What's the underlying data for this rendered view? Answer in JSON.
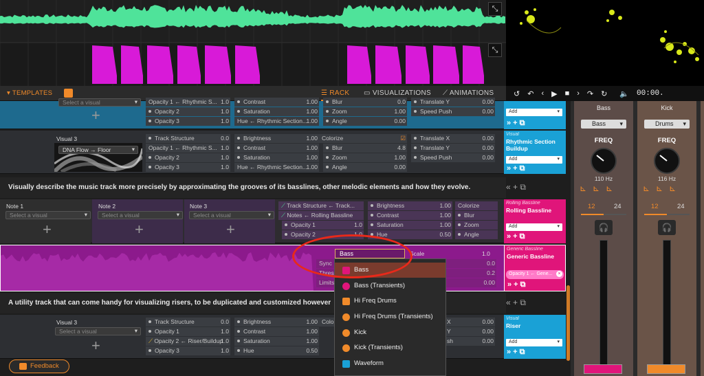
{
  "toolbar": {
    "templates": "TEMPLATES",
    "rack": "RACK",
    "visualizations": "VISUALIZATIONS",
    "animations": "ANIMATIONS"
  },
  "transport": {
    "time": "00:00."
  },
  "colors": {
    "accent": "#f08a2a",
    "green_wave": "#4fe39a",
    "magenta_wave": "#d81ad8",
    "track_blue": "#1aa1d6",
    "track_pink": "#e0157a",
    "highlight_ring": "#e8291a"
  },
  "row1": {
    "visual_select": "Select a visual",
    "params": [
      {
        "label": "Opacity 1 ← Rhythmic S...",
        "value": "1.0"
      },
      {
        "label": "Opacity 2",
        "value": "1.0"
      },
      {
        "label": "Opacity 3",
        "value": "1.0"
      },
      {
        "label": "Contrast",
        "value": "1.00"
      },
      {
        "label": "Saturation",
        "value": "1.00"
      },
      {
        "label": "Hue ← Rhythmic Section...",
        "value": "1.00"
      },
      {
        "label": "Blur",
        "value": "0.0"
      },
      {
        "label": "Zoom",
        "value": "1.00"
      },
      {
        "label": "Angle",
        "value": "0.00"
      },
      {
        "label": "Translate Y",
        "value": "0.00"
      },
      {
        "label": "Speed Push",
        "value": "0.00"
      }
    ],
    "card": {
      "add": "Add"
    }
  },
  "row2": {
    "title": "Visual 3",
    "visual": "DNA Flow → Floor",
    "params": [
      {
        "label": "Track Structure",
        "value": "0.0"
      },
      {
        "label": "Opacity 1 ← Rhythmic S...",
        "value": "1.0"
      },
      {
        "label": "Opacity 2",
        "value": "1.0"
      },
      {
        "label": "Opacity 3",
        "value": "1.0"
      },
      {
        "label": "Brightness",
        "value": "1.00"
      },
      {
        "label": "Contrast",
        "value": "1.00"
      },
      {
        "label": "Saturation",
        "value": "1.00"
      },
      {
        "label": "Hue ← Rhythmic Section...",
        "value": "1.00"
      },
      {
        "label": "Colorize",
        "value": ""
      },
      {
        "label": "Blur",
        "value": "4.8"
      },
      {
        "label": "Zoom",
        "value": "1.00"
      },
      {
        "label": "Angle",
        "value": "0.00"
      },
      {
        "label": "Translate X",
        "value": "0.00"
      },
      {
        "label": "Translate Y",
        "value": "0.00"
      },
      {
        "label": "Speed Push",
        "value": "0.00"
      }
    ],
    "card": {
      "category": "Visual",
      "name": "Rhythmic Section Buildup",
      "add": "Add"
    }
  },
  "desc1": "Visually describe the music track more precisely by approximating the grooves of its basslines, other melodic elements and how they evolve.",
  "row3": {
    "notes": [
      {
        "title": "Note 1",
        "select": "Select a visual"
      },
      {
        "title": "Note 2",
        "select": "Select a visual"
      },
      {
        "title": "Note 3",
        "select": "Select a visual"
      }
    ],
    "params": [
      {
        "label": "Track Structure ← Track...",
        "value": ""
      },
      {
        "label": "Notes ← Rolling Bassline",
        "value": ""
      },
      {
        "label": "Opacity 1",
        "value": "1.0"
      },
      {
        "label": "Opacity 2",
        "value": "1.0"
      },
      {
        "label": "Brightness",
        "value": "1.00"
      },
      {
        "label": "Contrast",
        "value": "1.00"
      },
      {
        "label": "Saturation",
        "value": "1.00"
      },
      {
        "label": "Hue",
        "value": "0.50"
      },
      {
        "label": "Colorize",
        "value": ""
      },
      {
        "label": "Blur",
        "value": ""
      },
      {
        "label": "Zoom",
        "value": ""
      },
      {
        "label": "Angle",
        "value": ""
      }
    ],
    "card": {
      "category": "Rolling Bassline",
      "name": "Rolling Bassline",
      "add": "Add"
    }
  },
  "row4": {
    "input_value": "Bass",
    "scale_label": "Scale",
    "params": [
      {
        "label": "Sync",
        "value": "0.0"
      },
      {
        "label": "Thres",
        "value": "0.2"
      },
      {
        "label": "Limits",
        "value": "0.00"
      }
    ],
    "scale_value": "1.0",
    "card": {
      "category": "Generic Bassline",
      "name": "Generic Bassline",
      "chip": "Opacity 1 ← Gene..."
    }
  },
  "desc2": "A utility track that can come handy for visualizing risers, to be duplicated and customized however",
  "row5": {
    "title": "Visual 3",
    "visual_select": "Select a visual",
    "params": [
      {
        "label": "Track Structure",
        "value": "0.0"
      },
      {
        "label": "Opacity 1",
        "value": "1.0"
      },
      {
        "label": "Opacity 2 ← Riser/Buildup",
        "value": "1.0"
      },
      {
        "label": "Opacity 3",
        "value": "1.0"
      },
      {
        "label": "Brightness",
        "value": "1.00"
      },
      {
        "label": "Contrast",
        "value": "1.00"
      },
      {
        "label": "Saturation",
        "value": "1.00"
      },
      {
        "label": "Hue",
        "value": "0.50"
      },
      {
        "label": "Colo",
        "value": ""
      },
      {
        "label": "X",
        "value": "0.00"
      },
      {
        "label": "Y",
        "value": "0.00"
      },
      {
        "label": "sh",
        "value": "0.00"
      }
    ],
    "card": {
      "category": "Visual",
      "name": "Riser",
      "add": "Add"
    }
  },
  "dropdown": [
    "Bass",
    "Bass (Transients)",
    "Hi Freq Drums",
    "Hi Freq Drums (Transients)",
    "Kick",
    "Kick (Transients)",
    "Waveform"
  ],
  "mixer": [
    {
      "title": "Bass",
      "source": "Bass",
      "freq_label": "FREQ",
      "freq": "110 Hz",
      "slope_a": "12",
      "slope_b": "24"
    },
    {
      "title": "Kick",
      "source": "Drums",
      "freq_label": "FREQ",
      "freq": "116 Hz",
      "slope_a": "12",
      "slope_b": "24"
    }
  ],
  "feedback": "Feedback"
}
